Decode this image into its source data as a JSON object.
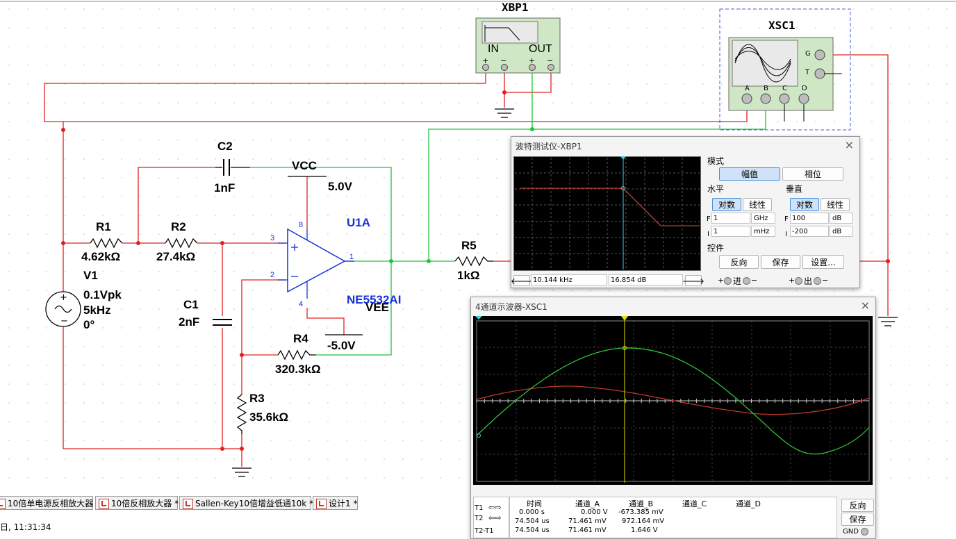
{
  "schematic": {
    "instruments": {
      "bode_label": "XBP1",
      "bode_in": "IN",
      "bode_out": "OUT",
      "scope_label": "XSC1",
      "scope_pins": [
        "A",
        "B",
        "C",
        "D"
      ],
      "scope_g": "G",
      "scope_t": "T"
    },
    "components": {
      "c2_name": "C2",
      "c2_value": "1nF",
      "vcc_name": "VCC",
      "vcc_value": "5.0V",
      "u1_name": "U1A",
      "u1_model": "NE5532AI",
      "vee_name": "VEE",
      "vee_value": "-5.0V",
      "r1_name": "R1",
      "r1_value": "4.62kΩ",
      "r2_name": "R2",
      "r2_value": "27.4kΩ",
      "c1_name": "C1",
      "c1_value": "2nF",
      "r4_name": "R4",
      "r4_value": "320.3kΩ",
      "r3_name": "R3",
      "r3_value": "35.6kΩ",
      "r5_name": "R5",
      "r5_value": "1kΩ",
      "v1_name": "V1",
      "v1_amp": "0.1Vpk",
      "v1_freq": "5kHz",
      "v1_phase": "0°"
    },
    "pins": {
      "p3": "3",
      "p2": "2",
      "p8": "8",
      "p4": "4",
      "p1": "1"
    }
  },
  "bode_window": {
    "title": "波特测试仪-XBP1",
    "close": "×",
    "mode_label": "模式",
    "mode_buttons": [
      "幅值",
      "相位"
    ],
    "horizontal_label": "水平",
    "vertical_label": "垂直",
    "h_scale": [
      "对数",
      "线性"
    ],
    "v_scale": [
      "对数",
      "线性"
    ],
    "h_final": {
      "prefix": "F",
      "value": "1",
      "unit": "GHz"
    },
    "h_initial": {
      "prefix": "I",
      "value": "1",
      "unit": "mHz"
    },
    "v_final": {
      "prefix": "F",
      "value": "100",
      "unit": "dB"
    },
    "v_initial": {
      "prefix": "I",
      "value": "-200",
      "unit": "dB"
    },
    "controls_label": "控件",
    "control_buttons": [
      "反向",
      "保存",
      "设置..."
    ],
    "cursor_freq": "10.144 kHz",
    "cursor_gain": "16.854 dB",
    "in_label": "进",
    "out_label": "出",
    "plus": "+",
    "minus": "−",
    "colors": {
      "plot_bg": "#000000",
      "trace": "#c0392b",
      "cursor": "#3ad3e0"
    }
  },
  "scope_window": {
    "title": "4通道示波器-XSC1",
    "close": "×",
    "colors": {
      "plot_bg": "#000000",
      "channel_a": "#c0392b",
      "channel_b": "#2fbf3a",
      "cursor": "#e0e000"
    },
    "table_headers": [
      "时间",
      "通道_A",
      "通道_B",
      "通道_C",
      "通道_D"
    ],
    "rows": [
      {
        "label": "T1",
        "time": "0.000 s",
        "a": "0.000 V",
        "b": "-673.385 mV"
      },
      {
        "label": "T2",
        "time": "74.504 us",
        "a": "71.461 mV",
        "b": "972.164 mV"
      },
      {
        "label": "T2-T1",
        "time": "74.504 us",
        "a": "71.461 mV",
        "b": "1.646 V"
      }
    ],
    "buttons": [
      "反向",
      "保存"
    ],
    "gnd_label": "GND"
  },
  "tabs": [
    "10倍单电源反相放大器",
    "10倍反相放大器 *",
    "Sallen-Key10倍增益低通10k *",
    "设计1 *"
  ],
  "status": {
    "timestamp": "日, 11:31:34"
  }
}
